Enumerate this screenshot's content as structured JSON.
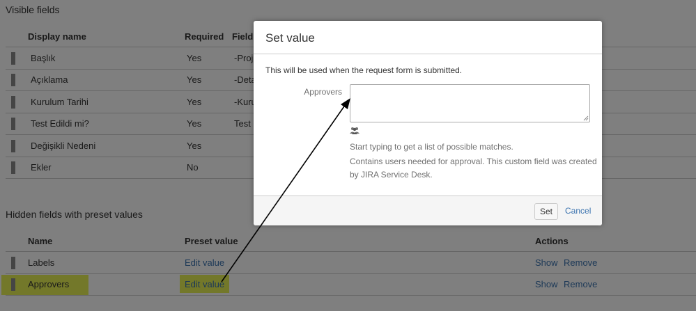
{
  "visible_fields": {
    "section_title": "Visible fields",
    "headers": {
      "display_name": "Display name",
      "required": "Required",
      "field": "Field"
    },
    "rows": [
      {
        "name": "Başlık",
        "required": "Yes",
        "field": "-Proje"
      },
      {
        "name": "Açıklama",
        "required": "Yes",
        "field": "-Deta"
      },
      {
        "name": "Kurulum Tarihi",
        "required": "Yes",
        "field": "-Kuru"
      },
      {
        "name": "Test Edildi mi?",
        "required": "Yes",
        "field": "Test G"
      },
      {
        "name": "Değişikli Nedeni",
        "required": "Yes",
        "field": ""
      },
      {
        "name": "Ekler",
        "required": "No",
        "field": ""
      }
    ]
  },
  "hidden_fields": {
    "section_title": "Hidden fields with preset values",
    "headers": {
      "name": "Name",
      "preset_value": "Preset value",
      "actions": "Actions"
    },
    "rows": [
      {
        "name": "Labels",
        "preset": "Edit value",
        "show": "Show",
        "remove": "Remove"
      },
      {
        "name": "Approvers",
        "preset": "Edit value",
        "show": "Show",
        "remove": "Remove"
      }
    ]
  },
  "dialog": {
    "title": "Set value",
    "description": "This will be used when the request form is submitted.",
    "field_label": "Approvers",
    "field_value": "",
    "icon": "users-icon",
    "help_1": "Start typing to get a list of possible matches.",
    "help_2a": "Contains users needed for approval. This custom field was created",
    "help_2b": "by JIRA Service Desk.",
    "set_label": "Set",
    "cancel_label": "Cancel"
  },
  "colors": {
    "highlight": "#e6f055",
    "link": "#3b73af",
    "overlay": "rgba(0,0,0,0.5)"
  }
}
